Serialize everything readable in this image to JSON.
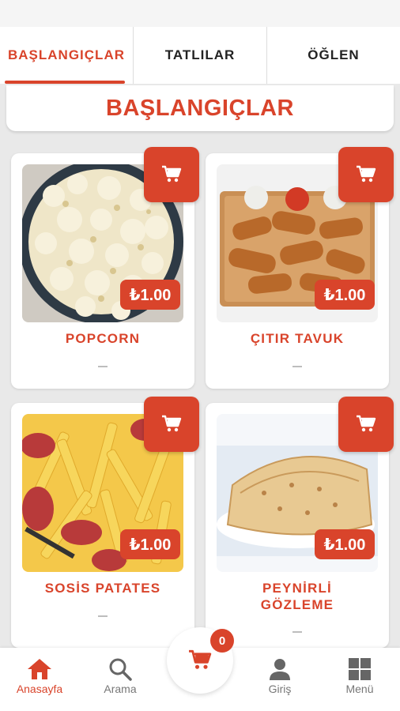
{
  "tabs": [
    {
      "label": "BAŞLANGIÇLAR",
      "active": true
    },
    {
      "label": "TATLILAR",
      "active": false
    },
    {
      "label": "ÖĞLEN",
      "active": false
    }
  ],
  "section": {
    "title": "BAŞLANGIÇLAR"
  },
  "products": [
    {
      "name": "POPCORN",
      "price": "₺1.00",
      "description": "—",
      "image": "popcorn-photo"
    },
    {
      "name": "ÇITIR TAVUK",
      "price": "₺1.00",
      "description": "—",
      "image": "fried-chicken-photo"
    },
    {
      "name": "SOSİS PATATES",
      "price": "₺1.00",
      "description": "—",
      "image": "sausage-fries-photo"
    },
    {
      "name": "PEYNİRLİ GÖZLEME",
      "price": "₺1.00",
      "description": "—",
      "image": "gozleme-photo"
    }
  ],
  "cart": {
    "count": "0",
    "icon": "cart-icon"
  },
  "nav": [
    {
      "label": "Anasayfa",
      "icon": "home-icon",
      "active": true
    },
    {
      "label": "Arama",
      "icon": "search-icon",
      "active": false
    },
    {
      "label": "Giriş",
      "icon": "person-icon",
      "active": false
    },
    {
      "label": "Menü",
      "icon": "grid-icon",
      "active": false
    }
  ],
  "colors": {
    "accent": "#d9442b",
    "background": "#e9e9e9",
    "card": "#ffffff",
    "inactive": "#777777"
  }
}
